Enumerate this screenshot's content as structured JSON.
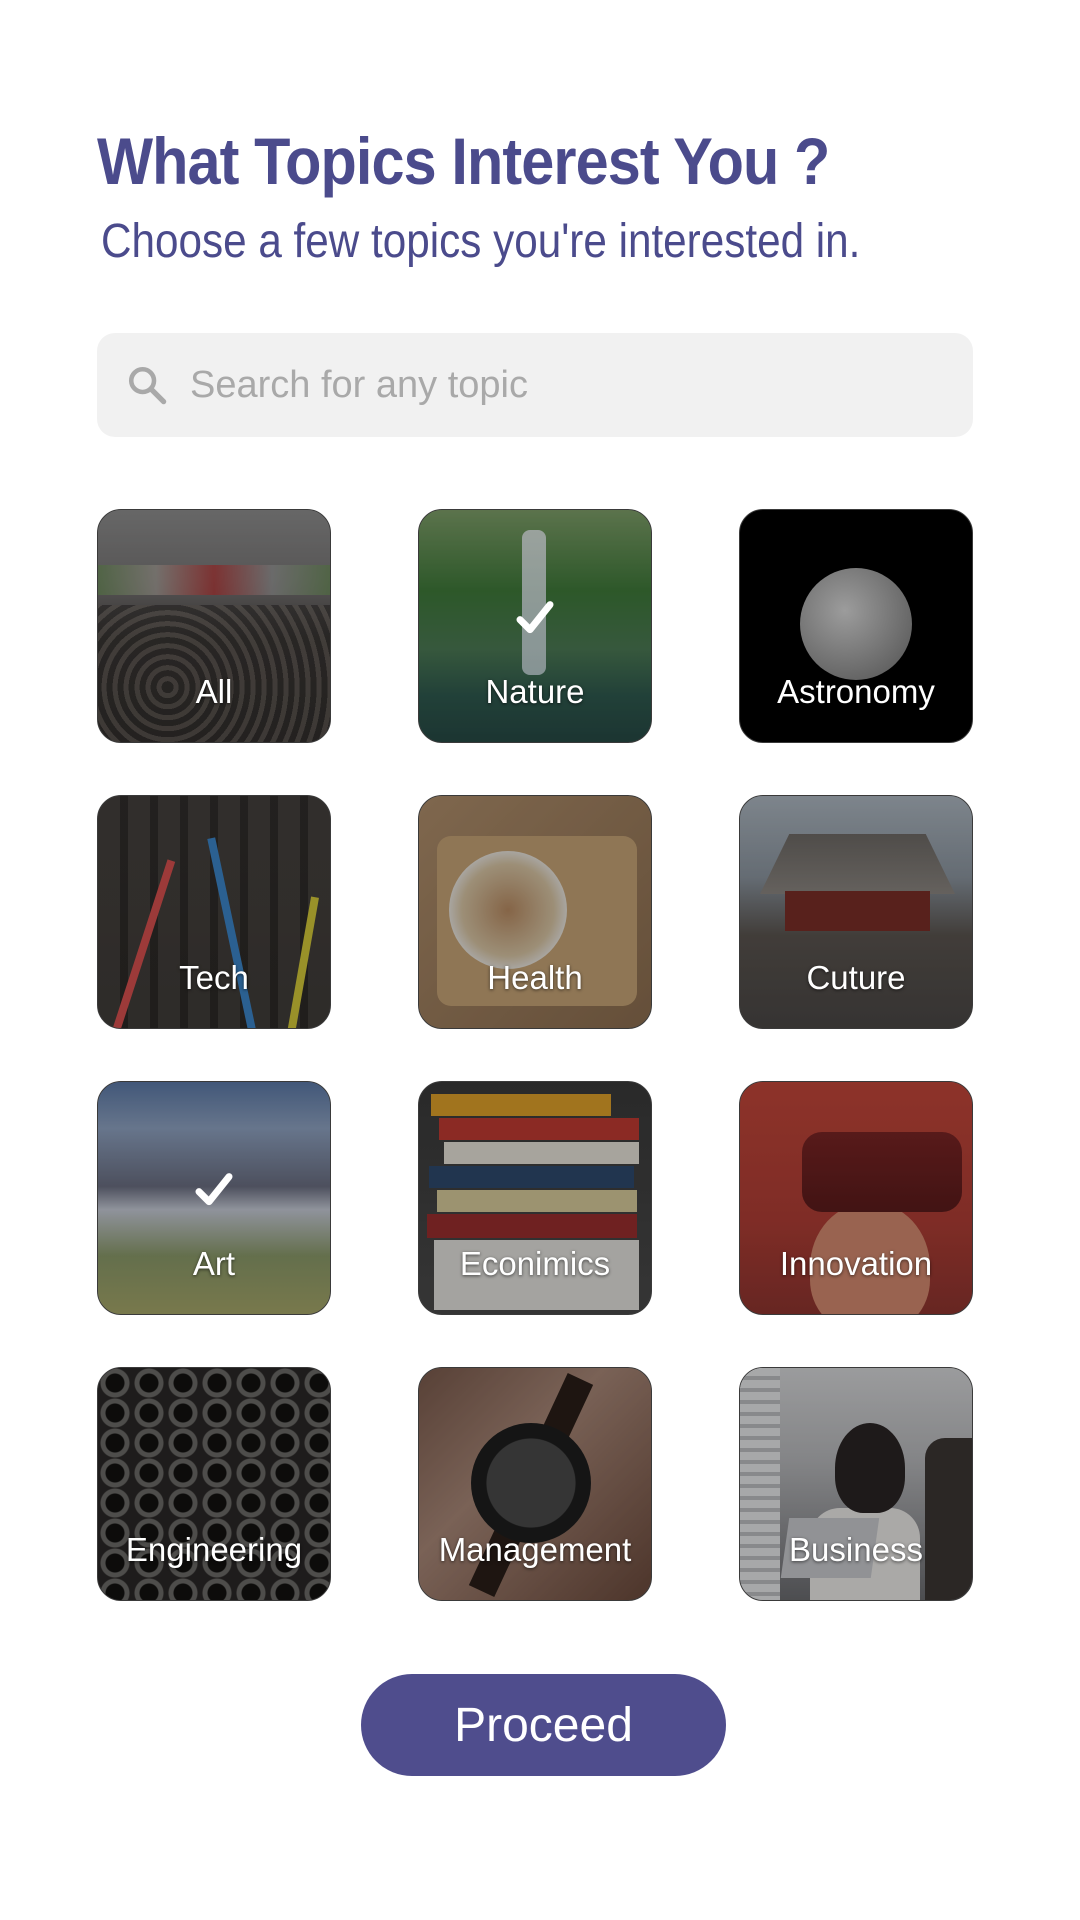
{
  "header": {
    "title": "What Topics Interest You ?",
    "subtitle": "Choose a few topics you're interested in."
  },
  "search": {
    "placeholder": "Search for any topic",
    "value": "",
    "icon": "search-icon"
  },
  "topics": [
    {
      "label": "All",
      "selected": false
    },
    {
      "label": "Nature",
      "selected": true
    },
    {
      "label": "Astronomy",
      "selected": false
    },
    {
      "label": "Tech",
      "selected": false
    },
    {
      "label": "Health",
      "selected": false
    },
    {
      "label": "Cuture",
      "selected": false
    },
    {
      "label": "Art",
      "selected": true
    },
    {
      "label": "Econimics",
      "selected": false
    },
    {
      "label": "Innovation",
      "selected": false
    },
    {
      "label": "Engineering",
      "selected": false
    },
    {
      "label": "Management",
      "selected": false
    },
    {
      "label": "Business",
      "selected": false
    }
  ],
  "actions": {
    "proceed_label": "Proceed"
  },
  "colors": {
    "accent": "#4b4b8c",
    "button": "#4f4d8d",
    "search_bg": "#f1f1f1",
    "placeholder": "#a9a9a9"
  }
}
